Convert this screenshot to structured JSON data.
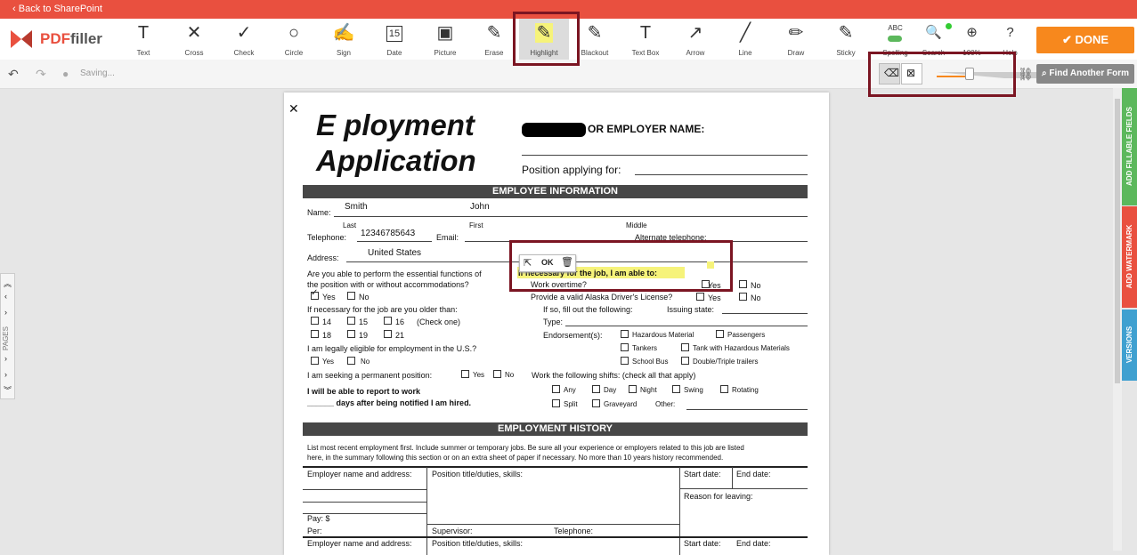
{
  "topbar": {
    "back_label": "Back to SharePoint"
  },
  "logo": {
    "pdf": "PDF",
    "filler": "filler"
  },
  "tools": [
    {
      "id": "text",
      "label": "Text",
      "icon": "T"
    },
    {
      "id": "cross",
      "label": "Cross",
      "icon": "✕"
    },
    {
      "id": "check",
      "label": "Check",
      "icon": "✓"
    },
    {
      "id": "circle",
      "label": "Circle",
      "icon": "○"
    },
    {
      "id": "sign",
      "label": "Sign",
      "icon": "✍"
    },
    {
      "id": "date",
      "label": "Date",
      "icon": "15"
    },
    {
      "id": "picture",
      "label": "Picture",
      "icon": "▣"
    },
    {
      "id": "erase",
      "label": "Erase",
      "icon": "✎"
    },
    {
      "id": "highlight",
      "label": "Highlight",
      "icon": "✎"
    },
    {
      "id": "blackout",
      "label": "Blackout",
      "icon": "✎"
    },
    {
      "id": "textbox",
      "label": "Text Box",
      "icon": "T"
    },
    {
      "id": "arrow",
      "label": "Arrow",
      "icon": "↗"
    },
    {
      "id": "line",
      "label": "Line",
      "icon": "╱"
    },
    {
      "id": "draw",
      "label": "Draw",
      "icon": "✏"
    },
    {
      "id": "sticky",
      "label": "Sticky",
      "icon": "✎"
    }
  ],
  "right_tools": [
    {
      "id": "spelling",
      "label": "Spelling",
      "icon": "ABC"
    },
    {
      "id": "search",
      "label": "Search",
      "icon": "🔍"
    },
    {
      "id": "zoom",
      "label": "100%",
      "icon": "⊕"
    },
    {
      "id": "help",
      "label": "Help",
      "icon": "?"
    }
  ],
  "done_label": "DONE",
  "done_icon": "✔",
  "subbar": {
    "saving": "Saving...",
    "find_form": "Find Another Form"
  },
  "popup": {
    "ok": "OK"
  },
  "side_tabs": [
    {
      "label": "ADD FILLABLE FIELDS",
      "color": "#5cb85c"
    },
    {
      "label": "ADD WATERMARK",
      "color": "#e9503f"
    },
    {
      "label": "VERSIONS",
      "color": "#3fa0d0"
    }
  ],
  "pages_label": "PAGES",
  "doc": {
    "title1": "E   ployment",
    "title2": "Application",
    "employer_name": "OR EMPLOYER NAME:",
    "position_applying": "Position applying for:",
    "emp_info": "EMPLOYEE INFORMATION",
    "name_label": "Name:",
    "last_value": "Smith",
    "first_value": "John",
    "last": "Last",
    "first": "First",
    "middle": "Middle",
    "telephone": "Telephone:",
    "tel_value": "12346785643",
    "email": "Email:",
    "alt_tel": "Alternate telephone:",
    "address": "Address:",
    "address_value": "United States",
    "q_essential1": "Are you able to perform the essential functions of",
    "q_essential2": "the position with or without accommodations?",
    "yes": "Yes",
    "no": "No",
    "highlight_text": "If necessary for the job, I am able to:",
    "overtime": "Work overtime?",
    "license": "Provide a valid Alaska Driver's License?",
    "older_than": "If necessary for the job are you older than:",
    "ages": [
      "14",
      "15",
      "16",
      "18",
      "19",
      "21"
    ],
    "check_one": "(Check one)",
    "fill_following": "If so, fill out the following:",
    "issuing_state": "Issuing state:",
    "type": "Type:",
    "endorsements": "Endorsement(s):",
    "hazmat": "Hazardous Material",
    "passengers": "Passengers",
    "tankers": "Tankers",
    "tank_hazmat": "Tank with Hazardous Materials",
    "school_bus": "School Bus",
    "double_triple": "Double/Triple trailers",
    "eligible": "I am legally eligible for employment in the U.S.?",
    "permanent": "I am seeking a permanent position:",
    "shifts": "Work the following shifts: (check all that apply)",
    "shift_any": "Any",
    "shift_day": "Day",
    "shift_night": "Night",
    "shift_swing": "Swing",
    "shift_rotating": "Rotating",
    "shift_split": "Split",
    "shift_graveyard": "Graveyard",
    "shift_other": "Other:",
    "report1": "I will be able to report to work",
    "report2": "______ days after being notified I am hired.",
    "emp_history": "EMPLOYMENT HISTORY",
    "history1": "List most recent employment first. Include summer or temporary jobs. Be sure all your experience or employers related to this job are listed",
    "history2": "here, in the summary following this section or on an extra sheet of paper if necessary. No more than 10 years history recommended.",
    "employer_addr": "Employer name and address:",
    "position_title": "Position title/duties, skills:",
    "start_date": "Start date:",
    "end_date": "End date:",
    "reason_leaving": "Reason for leaving:",
    "pay": "Pay:   $",
    "per": "Per:",
    "supervisor": "Supervisor:",
    "telephone2": "Telephone:"
  }
}
